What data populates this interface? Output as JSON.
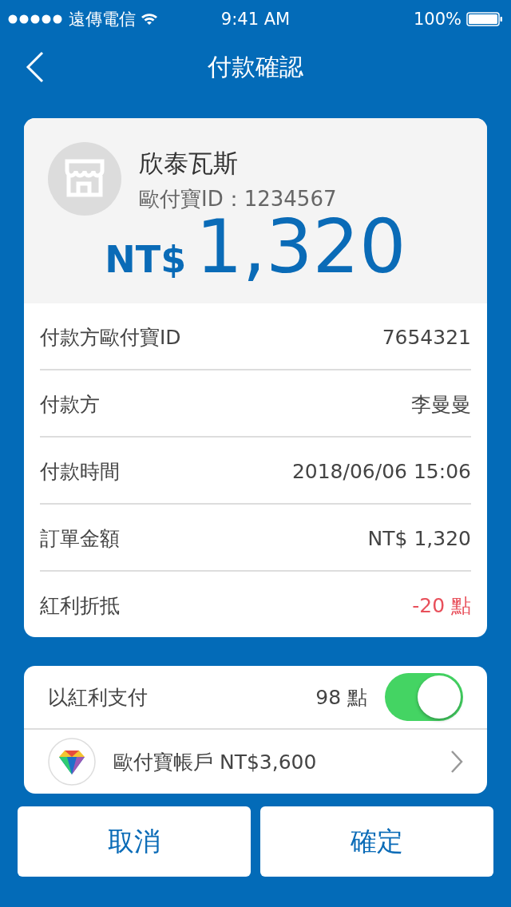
{
  "status_bar": {
    "carrier": "遠傳電信",
    "time": "9:41 AM",
    "battery": "100%"
  },
  "nav": {
    "title": "付款確認"
  },
  "merchant": {
    "name": "欣泰瓦斯",
    "id_line": "歐付寶ID：1234567",
    "currency": "NT$",
    "amount": "1,320"
  },
  "details": [
    {
      "label": "付款方歐付寶ID",
      "value": "7654321",
      "kind": "plain"
    },
    {
      "label": "付款方",
      "value": "李曼曼",
      "kind": "plain"
    },
    {
      "label": "付款時間",
      "value": "2018/06/06 15:06",
      "kind": "plain"
    },
    {
      "label": "訂單金額",
      "value": "NT$ 1,320",
      "kind": "plain"
    },
    {
      "label": "紅利折抵",
      "value": "-20 點",
      "kind": "deduction"
    }
  ],
  "bonus": {
    "label": "以紅利支付",
    "points": "98 點",
    "on": true
  },
  "account": {
    "label": "歐付寶帳戶 NT$3,600"
  },
  "buttons": [
    {
      "label": "取消"
    },
    {
      "label": "確定"
    }
  ]
}
